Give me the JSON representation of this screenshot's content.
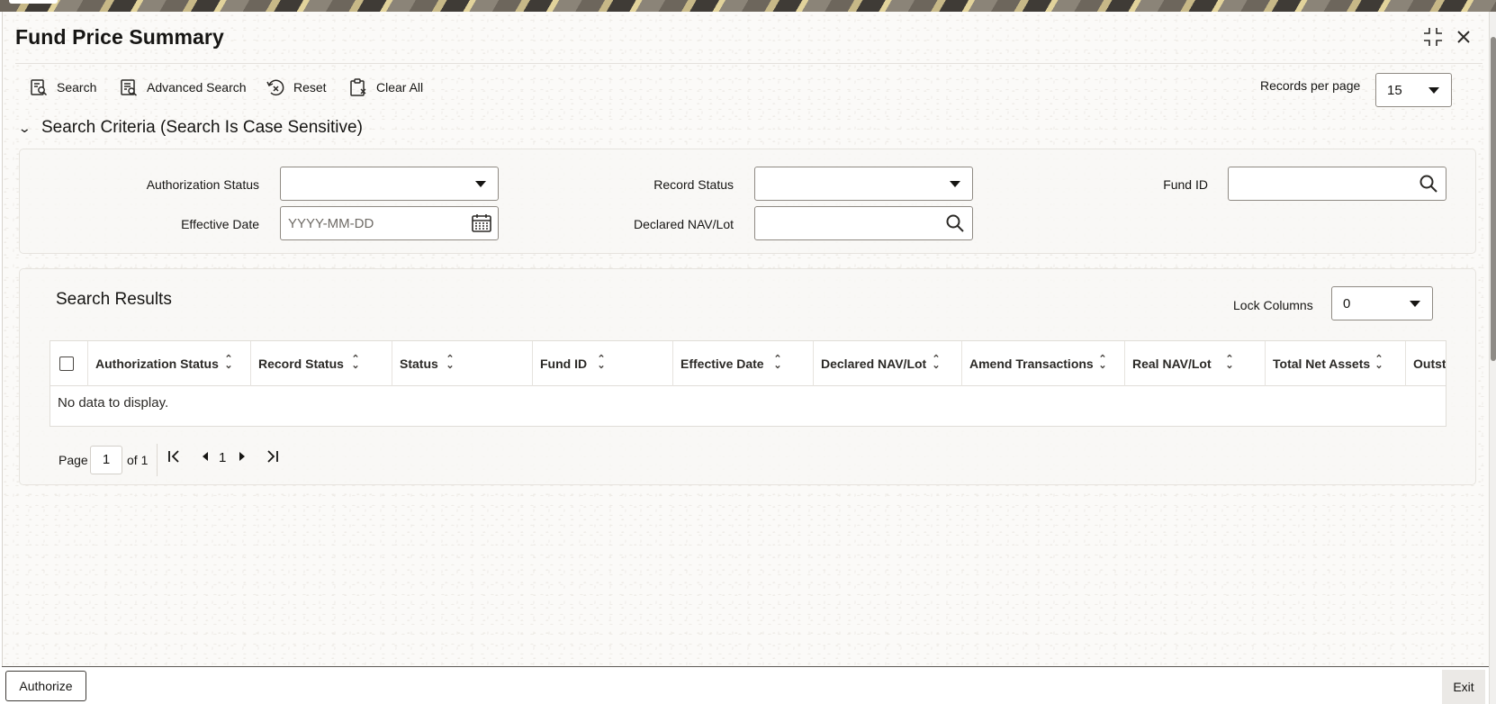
{
  "window": {
    "title": "Fund Price Summary"
  },
  "toolbar": {
    "search_label": "Search",
    "advanced_search_label": "Advanced Search",
    "reset_label": "Reset",
    "clear_all_label": "Clear All",
    "records_per_page_label": "Records per page",
    "records_per_page_value": "15"
  },
  "criteria": {
    "section_title": "Search Criteria (Search Is Case Sensitive)",
    "authorization_status_label": "Authorization Status",
    "authorization_status_value": "",
    "record_status_label": "Record Status",
    "record_status_value": "",
    "fund_id_label": "Fund ID",
    "fund_id_value": "",
    "effective_date_label": "Effective Date",
    "effective_date_placeholder": "YYYY-MM-DD",
    "declared_nav_label": "Declared NAV/Lot",
    "declared_nav_value": ""
  },
  "results": {
    "title": "Search Results",
    "lock_columns_label": "Lock Columns",
    "lock_columns_value": "0",
    "columns": [
      "Authorization Status",
      "Record Status",
      "Status",
      "Fund ID",
      "Effective Date",
      "Declared NAV/Lot",
      "Amend Transactions",
      "Real NAV/Lot",
      "Total Net Assets",
      "Outsta"
    ],
    "empty_message": "No data to display."
  },
  "pagination": {
    "page_label": "Page",
    "page_value": "1",
    "of_label": "of 1",
    "current_page": "1"
  },
  "footer": {
    "authorize_label": "Authorize",
    "exit_label": "Exit"
  },
  "icons": {
    "maximize": "collapse-arrows-icon",
    "close": "close-icon",
    "search": "search-doc-icon",
    "advanced_search": "advanced-search-icon",
    "reset": "reset-icon",
    "clear_all": "clipboard-clear-icon",
    "calendar": "calendar-icon",
    "magnifier": "magnifier-icon"
  }
}
